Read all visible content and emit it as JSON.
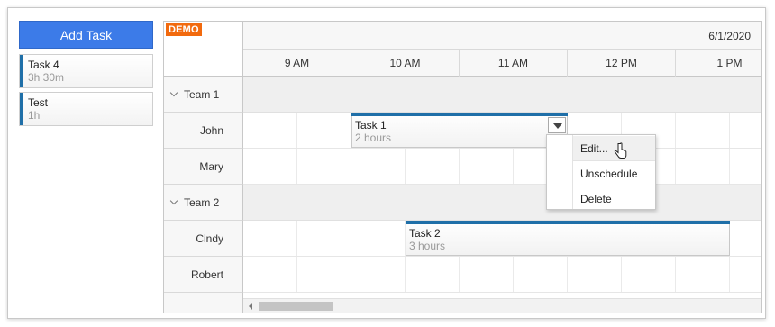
{
  "queue": {
    "add_button": "Add Task",
    "items": [
      {
        "name": "Task 4",
        "duration": "3h 30m"
      },
      {
        "name": "Test",
        "duration": "1h"
      }
    ]
  },
  "scheduler": {
    "demo_badge": "DEMO",
    "date": "6/1/2020",
    "hours": [
      "9 AM",
      "10 AM",
      "11 AM",
      "12 PM",
      "1 PM"
    ],
    "rows": [
      {
        "type": "group",
        "label": "Team 1"
      },
      {
        "type": "resource",
        "label": "John"
      },
      {
        "type": "resource",
        "label": "Mary"
      },
      {
        "type": "group",
        "label": "Team 2"
      },
      {
        "type": "resource",
        "label": "Cindy"
      },
      {
        "type": "resource",
        "label": "Robert"
      }
    ],
    "events": [
      {
        "name": "Task 1",
        "duration": "2 hours",
        "resource": "John",
        "start": "10 AM",
        "end": "12 PM"
      },
      {
        "name": "Task 2",
        "duration": "3 hours",
        "resource": "Cindy",
        "start": "10:30 AM",
        "end": "1:30 PM"
      }
    ],
    "bar_color": "#1f6fa8"
  },
  "context_menu": {
    "items": [
      "Edit...",
      "Unschedule",
      "Delete"
    ]
  },
  "colors": {
    "accent": "#3c7be8",
    "demo": "#f26a0e"
  }
}
